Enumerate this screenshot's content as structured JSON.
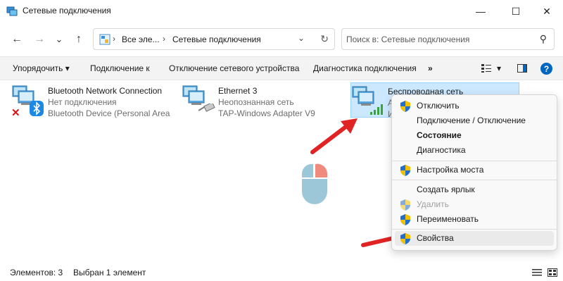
{
  "window": {
    "title": "Сетевые подключения",
    "minimize_glyph": "—",
    "maximize_glyph": "☐",
    "close_glyph": "✕"
  },
  "nav": {
    "back_glyph": "←",
    "forward_glyph": "→",
    "history_glyph": "⌄",
    "up_glyph": "↑",
    "refresh_glyph": "↻"
  },
  "address": {
    "crumbs": [
      "Все эле...",
      "Сетевые подключения"
    ],
    "separator": "›",
    "dropdown_glyph": "⌄"
  },
  "search": {
    "placeholder": "Поиск в: Сетевые подключения",
    "icon_glyph": "⚲"
  },
  "toolbar": {
    "organize": "Упорядочить",
    "organize_arrow": "▾",
    "connect": "Подключение к",
    "disable": "Отключение сетевого устройства",
    "diagnose": "Диагностика подключения",
    "more": "»",
    "view_arrow": "▾",
    "help": "?"
  },
  "connections": [
    {
      "name": "Bluetooth Network Connection",
      "status": "Нет подключения",
      "device": "Bluetooth Device (Personal Area ...",
      "overlay": "red-x-icon"
    },
    {
      "name": "Ethernet 3",
      "status": "Неопознанная сеть",
      "device": "TAP-Windows Adapter V9",
      "overlay": "network-cable-icon"
    },
    {
      "name": "Беспроводная сеть",
      "status": "А",
      "device": "И",
      "overlay": "wifi-signal-icon"
    }
  ],
  "context_menu": {
    "items": [
      {
        "label": "Отключить",
        "shield": true,
        "style": "normal"
      },
      {
        "label": "Подключение / Отключение",
        "shield": false,
        "style": "normal"
      },
      {
        "label": "Состояние",
        "shield": false,
        "style": "bold"
      },
      {
        "label": "Диагностика",
        "shield": false,
        "style": "normal"
      },
      {
        "label": "Настройка моста",
        "shield": true,
        "style": "normal"
      },
      {
        "label": "Создать ярлык",
        "shield": false,
        "style": "normal"
      },
      {
        "label": "Удалить",
        "shield": true,
        "style": "disabled"
      },
      {
        "label": "Переименовать",
        "shield": true,
        "style": "normal"
      },
      {
        "label": "Свойства",
        "shield": true,
        "style": "hover"
      }
    ]
  },
  "statusbar": {
    "count": "Элементов: 3",
    "selected": "Выбран 1 элемент"
  },
  "colors": {
    "accent": "#0067c0",
    "selection": "#cce8ff",
    "arrow": "#e02424",
    "mouse_body": "#9cc7d9",
    "mouse_button": "#f08a7e"
  }
}
